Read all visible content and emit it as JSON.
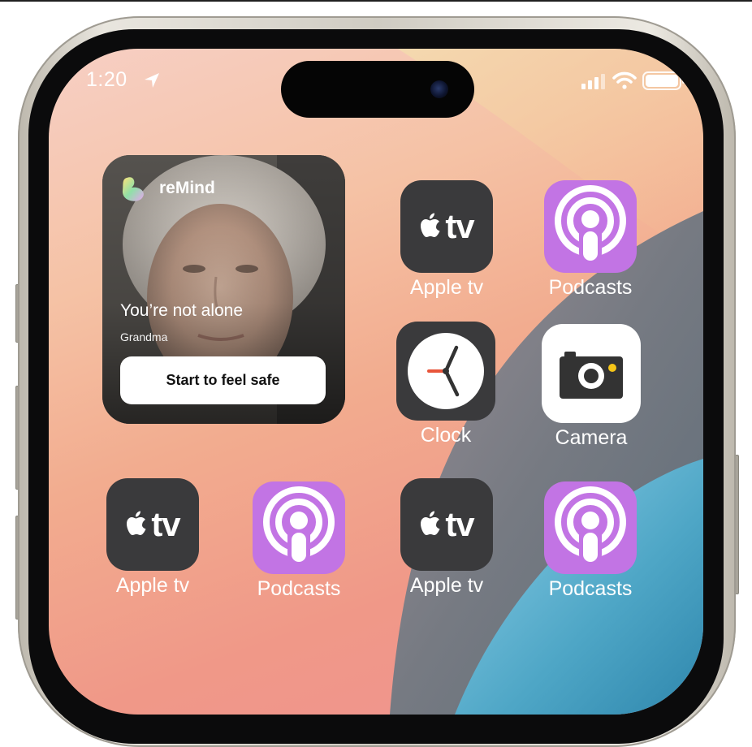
{
  "status_bar": {
    "time": "1:20",
    "location_icon": "location-arrow-icon",
    "signal_icon": "cellular-signal-icon",
    "wifi_icon": "wifi-icon",
    "battery_icon": "battery-icon"
  },
  "widget": {
    "app_name": "reMind",
    "title": "You’re not alone",
    "subtitle": "Grandma",
    "button_label": "Start to feel safe",
    "logo_icon": "remind-logo-icon"
  },
  "apps": [
    {
      "label": "Apple tv",
      "icon": "apple-tv-icon",
      "mark": "tv"
    },
    {
      "label": "Podcasts",
      "icon": "podcasts-icon"
    },
    {
      "label": "Clock",
      "icon": "clock-icon"
    },
    {
      "label": "Camera",
      "icon": "camera-icon"
    },
    {
      "label": "Apple tv",
      "icon": "apple-tv-icon",
      "mark": "tv"
    },
    {
      "label": "Podcasts",
      "icon": "podcasts-icon"
    },
    {
      "label": "Apple tv",
      "icon": "apple-tv-icon",
      "mark": "tv"
    },
    {
      "label": "Podcasts",
      "icon": "podcasts-icon"
    }
  ],
  "colors": {
    "podcasts": "#c274e4",
    "tv_bg": "#3a3a3c",
    "clock_hand_red": "#e8553a",
    "camera_dot": "#f5c518"
  }
}
